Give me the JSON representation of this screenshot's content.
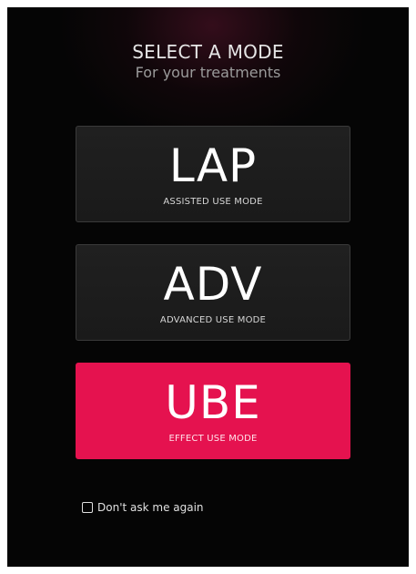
{
  "header": {
    "title": "SELECT A MODE",
    "subtitle": "For your treatments"
  },
  "modes": [
    {
      "code": "LAP",
      "description": "ASSISTED USE MODE",
      "selected": false
    },
    {
      "code": "ADV",
      "description": "ADVANCED USE MODE",
      "selected": false
    },
    {
      "code": "UBE",
      "description": "EFFECT USE MODE",
      "selected": true
    }
  ],
  "dont_ask": {
    "label": "Don't ask me again",
    "checked": false
  },
  "colors": {
    "accent": "#e5124f",
    "background": "#050505",
    "card": "#1e1e1e"
  }
}
